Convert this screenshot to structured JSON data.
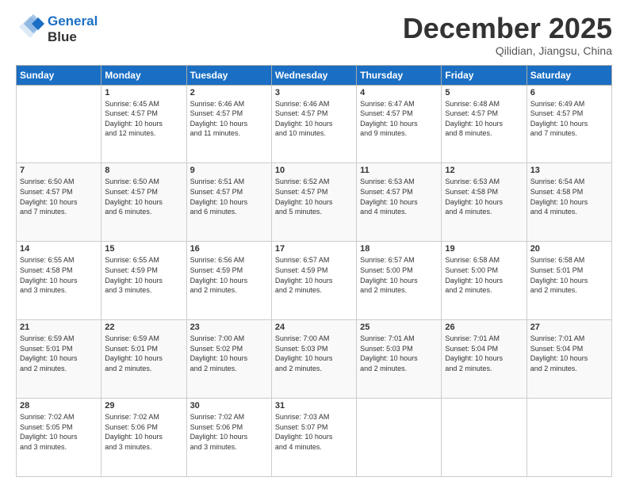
{
  "header": {
    "logo_line1": "General",
    "logo_line2": "Blue",
    "month": "December 2025",
    "location": "Qilidian, Jiangsu, China"
  },
  "weekdays": [
    "Sunday",
    "Monday",
    "Tuesday",
    "Wednesday",
    "Thursday",
    "Friday",
    "Saturday"
  ],
  "weeks": [
    [
      {
        "day": "",
        "info": ""
      },
      {
        "day": "1",
        "info": "Sunrise: 6:45 AM\nSunset: 4:57 PM\nDaylight: 10 hours\nand 12 minutes."
      },
      {
        "day": "2",
        "info": "Sunrise: 6:46 AM\nSunset: 4:57 PM\nDaylight: 10 hours\nand 11 minutes."
      },
      {
        "day": "3",
        "info": "Sunrise: 6:46 AM\nSunset: 4:57 PM\nDaylight: 10 hours\nand 10 minutes."
      },
      {
        "day": "4",
        "info": "Sunrise: 6:47 AM\nSunset: 4:57 PM\nDaylight: 10 hours\nand 9 minutes."
      },
      {
        "day": "5",
        "info": "Sunrise: 6:48 AM\nSunset: 4:57 PM\nDaylight: 10 hours\nand 8 minutes."
      },
      {
        "day": "6",
        "info": "Sunrise: 6:49 AM\nSunset: 4:57 PM\nDaylight: 10 hours\nand 7 minutes."
      }
    ],
    [
      {
        "day": "7",
        "info": "Sunrise: 6:50 AM\nSunset: 4:57 PM\nDaylight: 10 hours\nand 7 minutes."
      },
      {
        "day": "8",
        "info": "Sunrise: 6:50 AM\nSunset: 4:57 PM\nDaylight: 10 hours\nand 6 minutes."
      },
      {
        "day": "9",
        "info": "Sunrise: 6:51 AM\nSunset: 4:57 PM\nDaylight: 10 hours\nand 6 minutes."
      },
      {
        "day": "10",
        "info": "Sunrise: 6:52 AM\nSunset: 4:57 PM\nDaylight: 10 hours\nand 5 minutes."
      },
      {
        "day": "11",
        "info": "Sunrise: 6:53 AM\nSunset: 4:57 PM\nDaylight: 10 hours\nand 4 minutes."
      },
      {
        "day": "12",
        "info": "Sunrise: 6:53 AM\nSunset: 4:58 PM\nDaylight: 10 hours\nand 4 minutes."
      },
      {
        "day": "13",
        "info": "Sunrise: 6:54 AM\nSunset: 4:58 PM\nDaylight: 10 hours\nand 4 minutes."
      }
    ],
    [
      {
        "day": "14",
        "info": "Sunrise: 6:55 AM\nSunset: 4:58 PM\nDaylight: 10 hours\nand 3 minutes."
      },
      {
        "day": "15",
        "info": "Sunrise: 6:55 AM\nSunset: 4:59 PM\nDaylight: 10 hours\nand 3 minutes."
      },
      {
        "day": "16",
        "info": "Sunrise: 6:56 AM\nSunset: 4:59 PM\nDaylight: 10 hours\nand 2 minutes."
      },
      {
        "day": "17",
        "info": "Sunrise: 6:57 AM\nSunset: 4:59 PM\nDaylight: 10 hours\nand 2 minutes."
      },
      {
        "day": "18",
        "info": "Sunrise: 6:57 AM\nSunset: 5:00 PM\nDaylight: 10 hours\nand 2 minutes."
      },
      {
        "day": "19",
        "info": "Sunrise: 6:58 AM\nSunset: 5:00 PM\nDaylight: 10 hours\nand 2 minutes."
      },
      {
        "day": "20",
        "info": "Sunrise: 6:58 AM\nSunset: 5:01 PM\nDaylight: 10 hours\nand 2 minutes."
      }
    ],
    [
      {
        "day": "21",
        "info": "Sunrise: 6:59 AM\nSunset: 5:01 PM\nDaylight: 10 hours\nand 2 minutes."
      },
      {
        "day": "22",
        "info": "Sunrise: 6:59 AM\nSunset: 5:01 PM\nDaylight: 10 hours\nand 2 minutes."
      },
      {
        "day": "23",
        "info": "Sunrise: 7:00 AM\nSunset: 5:02 PM\nDaylight: 10 hours\nand 2 minutes."
      },
      {
        "day": "24",
        "info": "Sunrise: 7:00 AM\nSunset: 5:03 PM\nDaylight: 10 hours\nand 2 minutes."
      },
      {
        "day": "25",
        "info": "Sunrise: 7:01 AM\nSunset: 5:03 PM\nDaylight: 10 hours\nand 2 minutes."
      },
      {
        "day": "26",
        "info": "Sunrise: 7:01 AM\nSunset: 5:04 PM\nDaylight: 10 hours\nand 2 minutes."
      },
      {
        "day": "27",
        "info": "Sunrise: 7:01 AM\nSunset: 5:04 PM\nDaylight: 10 hours\nand 2 minutes."
      }
    ],
    [
      {
        "day": "28",
        "info": "Sunrise: 7:02 AM\nSunset: 5:05 PM\nDaylight: 10 hours\nand 3 minutes."
      },
      {
        "day": "29",
        "info": "Sunrise: 7:02 AM\nSunset: 5:06 PM\nDaylight: 10 hours\nand 3 minutes."
      },
      {
        "day": "30",
        "info": "Sunrise: 7:02 AM\nSunset: 5:06 PM\nDaylight: 10 hours\nand 3 minutes."
      },
      {
        "day": "31",
        "info": "Sunrise: 7:03 AM\nSunset: 5:07 PM\nDaylight: 10 hours\nand 4 minutes."
      },
      {
        "day": "",
        "info": ""
      },
      {
        "day": "",
        "info": ""
      },
      {
        "day": "",
        "info": ""
      }
    ]
  ]
}
